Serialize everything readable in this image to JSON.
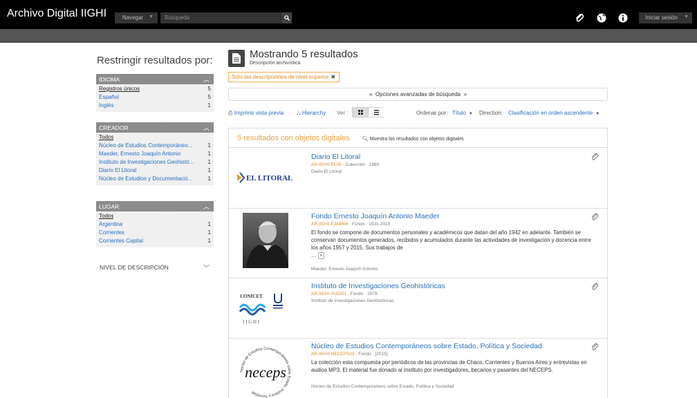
{
  "header": {
    "brand": "Archivo Digital IIGHI",
    "nav_label": "Navegar",
    "search_placeholder": "Búsqueda",
    "login_label": "Iniciar sesión",
    "icons": [
      "clipboard-icon",
      "globe-icon",
      "info-icon"
    ]
  },
  "sidebar": {
    "title": "Restringir resultados por:",
    "facets": [
      {
        "title": "IDIOMA",
        "items": [
          {
            "label": "Registros únicos",
            "count": "5"
          },
          {
            "label": "Español",
            "count": "5"
          },
          {
            "label": "Inglés",
            "count": "1"
          }
        ]
      },
      {
        "title": "CREADOR",
        "items": [
          {
            "label": "Todos",
            "count": ""
          },
          {
            "label": "Núcleo de Estudios Contemporáneo...",
            "count": "1"
          },
          {
            "label": "Maeder, Ernesto Joaquín Antonio",
            "count": "1"
          },
          {
            "label": "Instituto de Investigaciones Geohistó...",
            "count": "1"
          },
          {
            "label": "Diario El Litoral",
            "count": "1"
          },
          {
            "label": "Núcleo de Estudios y Documentació...",
            "count": "1"
          }
        ]
      },
      {
        "title": "LUGAR",
        "items": [
          {
            "label": "Todos",
            "count": ""
          },
          {
            "label": "Argentina",
            "count": "1"
          },
          {
            "label": "Corrientes",
            "count": "1"
          },
          {
            "label": "Corrientes Capital",
            "count": "1"
          }
        ]
      }
    ],
    "collapsed_facet": "NIVEL DE DESCRIPCIÓN"
  },
  "main": {
    "title": "Mostrando 5 resultados",
    "subtitle": "Descripción archivística",
    "filter_tag": "Sólo las descripciones de nivel superior",
    "advanced_search": "Opciones avanzadas de búsqueda",
    "print_label": "Imprimir vista previa",
    "hierarchy_label": "Hierarchy",
    "view_label": "Ver :",
    "sort_label": "Ordenar por:",
    "sort_value": "Título",
    "direction_label": "Direction:",
    "direction_value": "Clasificación en orden ascendente",
    "results_count": "5 resultados con objetos digitales",
    "results_link": "Muestra los resultados con objetos digitales",
    "results": [
      {
        "title": "Diario El Litoral",
        "code": "AR-IIGHI-EL06",
        "level": "Colección",
        "date": "1960",
        "description": "",
        "creator": "Diario El Litoral",
        "thumb_text": "EL LITORAL"
      },
      {
        "title": "Fondo Ernesto Joaquín Antonio Maeder",
        "code": "AR-IIGHI-EJAM04",
        "level": "Fondo",
        "date": "1931-2015",
        "description": "El fondo se compone de documentos personales y académicos que datan del año 1942 en adelante. También se conservan documentos generados, recibidos y acumulados durante las actividades de investigación y docencia entre los años 1957 y 2015. Sus trabajos de",
        "creator": "Maeder, Ernesto Joaquín Antonio",
        "thumb_text": ""
      },
      {
        "title": "Instituto de Investigaciones Geohistóricas",
        "code": "AR-IIGHI-ISAD01",
        "level": "Fondo",
        "date": "1979-",
        "description": "",
        "creator": "Instituto de Investigaciones Geohistóricas",
        "thumb_text": "CONICET",
        "thumb_text2": "I I G H I"
      },
      {
        "title": "Núcleo de Estudios Contemporáneos sobre Estado, Política y Sociedad",
        "code": "AR-IIGHI-NECEPS03",
        "level": "Fondo",
        "date": "[2015]",
        "description": "La colección esta compuesta por periódicos de las provincias de Chaco, Corrientes y Buenos Aires y entrevistas en audios MP3. El material fue donado al Instituto por investigadores, becarios y pasantes del NECEPS.",
        "creator": "Núcleo de Estudios Contemporaneos sobre Estado, Política y Sociedad",
        "thumb_text": "neceps",
        "thumb_ring": "Núcleo de Estudios Contemporáneos sobre Estado, Política y Sociedad"
      }
    ]
  },
  "colors": {
    "topbar": "#000000",
    "link": "#2a6fbd",
    "accent": "#e8a23a",
    "facet_head": "#8a8a8a"
  }
}
